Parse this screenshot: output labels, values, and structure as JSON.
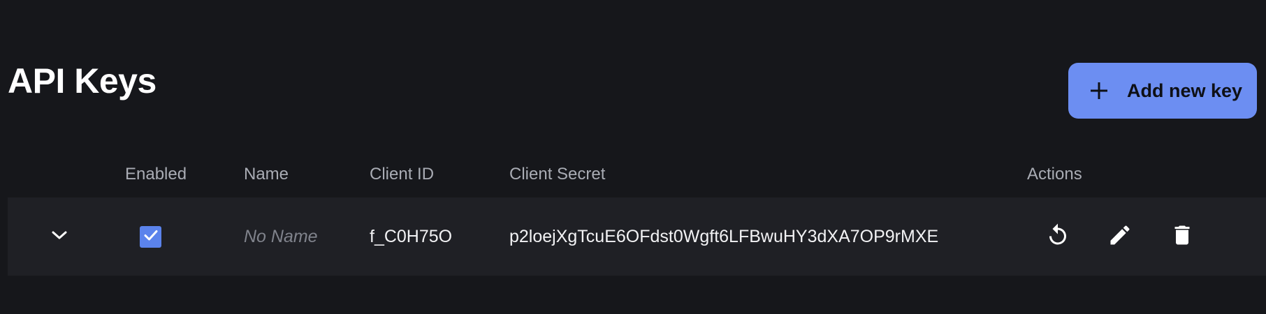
{
  "header": {
    "title": "API Keys",
    "add_button_label": "Add new key"
  },
  "table": {
    "columns": [
      "Enabled",
      "Name",
      "Client ID",
      "Client Secret",
      "Actions"
    ],
    "rows": [
      {
        "enabled": true,
        "name": "No Name",
        "client_id": "f_C0H75O",
        "client_secret": "p2loejXgTcuE6OFdst0Wgft6LFBwuHY3dXA7OP9rMXE",
        "actions": [
          "regenerate-icon",
          "edit-icon",
          "delete-icon"
        ]
      }
    ]
  },
  "colors": {
    "background": "#16171b",
    "row_background": "#1f2025",
    "accent": "#6c8ef2",
    "checkbox": "#5b83ec",
    "muted_text": "#a9acb4",
    "placeholder_text": "#80838c"
  }
}
